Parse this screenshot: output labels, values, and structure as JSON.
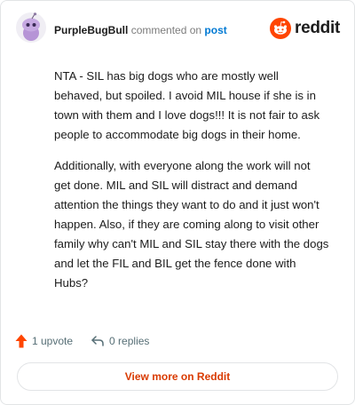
{
  "header": {
    "username": "PurpleBugBull",
    "action_text": "commented on",
    "post_link": "post",
    "logo_text": "reddit"
  },
  "comment": {
    "paragraphs": [
      "NTA - SIL has big dogs who are mostly well behaved, but spoiled. I avoid MIL house if she is in town with them and I love dogs!!! It is not fair to ask people to accommodate big dogs in their home.",
      "Additionally, with everyone along the work will not get done. MIL and SIL will distract and demand attention the things they want to do and it just won't happen. Also, if they are coming along to visit other family why can't MIL and SIL stay there with the dogs and let the FIL and BIL get the fence done with Hubs?"
    ]
  },
  "actions": {
    "upvote": "1 upvote",
    "replies": "0 replies"
  },
  "view_button": "View more on Reddit",
  "colors": {
    "brand": "#ff4500",
    "link": "#0079d3",
    "button_text": "#d93a00",
    "avatar_purple": "#b694d6"
  },
  "icons": [
    "avatar-icon",
    "reddit-logo-icon",
    "upvote-arrow-icon",
    "reply-arrow-icon"
  ]
}
